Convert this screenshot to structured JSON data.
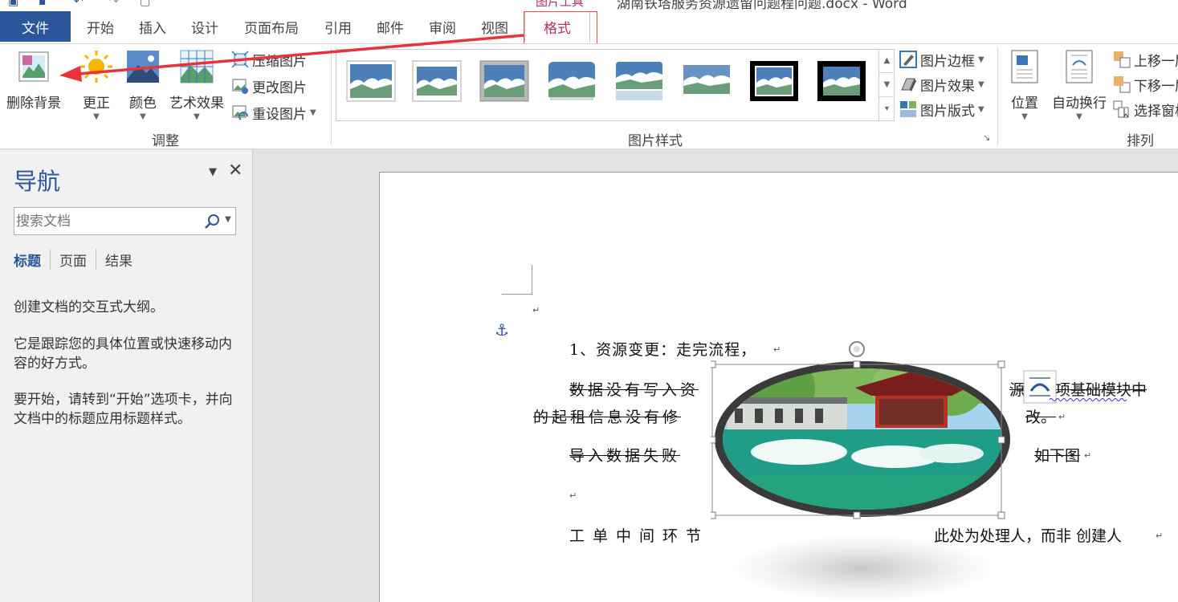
{
  "window": {
    "title": "湖南铁塔服务资源遗留问题程问题.docx - Word",
    "context_tab_group": "图片工具"
  },
  "tabs": {
    "file": "文件",
    "items": [
      "开始",
      "插入",
      "设计",
      "页面布局",
      "引用",
      "邮件",
      "审阅",
      "视图",
      "格式"
    ],
    "active": "格式"
  },
  "ribbon": {
    "adjust": {
      "remove_bg": "删除背景",
      "correct": "更正",
      "color": "颜色",
      "artistic": "艺术效果",
      "compress": "压缩图片",
      "change": "更改图片",
      "reset": "重设图片",
      "group_label": "调整"
    },
    "styles": {
      "border": "图片边框",
      "effects": "图片效果",
      "layout": "图片版式",
      "group_label": "图片样式"
    },
    "arrange": {
      "position": "位置",
      "wrap": "自动换行",
      "bring_forward": "上移一层",
      "send_backward": "下移一层",
      "selection_pane": "选择窗格",
      "group_label": "排列"
    }
  },
  "nav": {
    "title": "导航",
    "search_placeholder": "搜索文档",
    "tabs": [
      "标题",
      "页面",
      "结果"
    ],
    "text1": "创建文档的交互式大纲。",
    "text2": "它是跟踪您的具体位置或快速移动内容的好方式。",
    "text3": "要开始，请转到“开始”选项卡，并向文档中的标题应用标题样式。"
  },
  "document": {
    "line1": "1、资源变更：走完流程，",
    "line2a": "数据没有写入资",
    "line2b": "源变更项基础模块中",
    "line3a": "的起租信息没有修",
    "line3b": "改。",
    "line4a": "导入数据失败",
    "line4b": "如下图",
    "line6a": "工单中间环节",
    "line6b": "此处为处理人，而非 创建人"
  },
  "colors": {
    "word_blue": "#2b579a",
    "context_pink": "#b0306a",
    "arrow_red": "#e8333a"
  }
}
